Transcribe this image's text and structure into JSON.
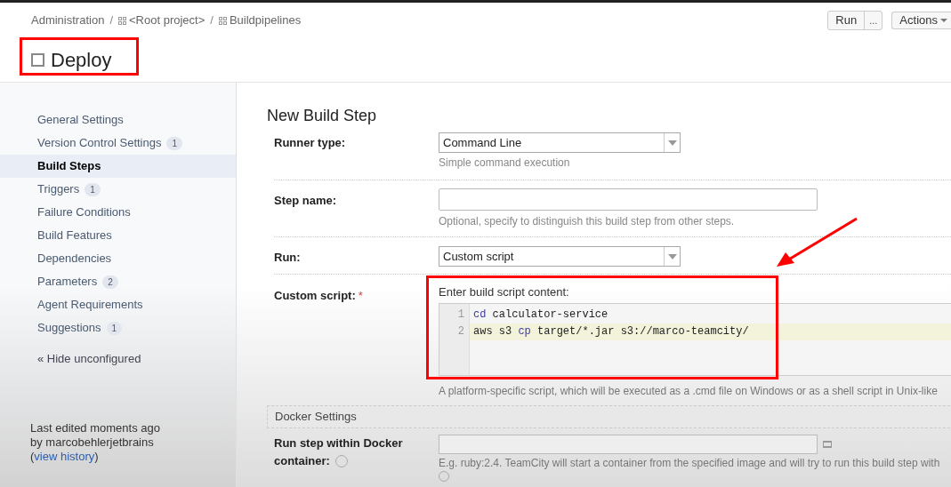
{
  "breadcrumbs": [
    "Administration",
    "<Root project>",
    "Buildpipelines"
  ],
  "breadcrumb_separator": "/",
  "header_buttons": {
    "run": "Run",
    "more": "...",
    "actions": "Actions"
  },
  "title": "Deploy",
  "sidebar": {
    "items": [
      {
        "label": "General Settings",
        "selected": false
      },
      {
        "label": "Version Control Settings",
        "count": "1",
        "selected": false
      },
      {
        "label": "Build Steps",
        "selected": true
      },
      {
        "label": "Triggers",
        "count": "1",
        "selected": false
      },
      {
        "label": "Failure Conditions",
        "selected": false
      },
      {
        "label": "Build Features",
        "selected": false
      },
      {
        "label": "Dependencies",
        "selected": false
      },
      {
        "label": "Parameters",
        "count": "2",
        "selected": false
      },
      {
        "label": "Agent Requirements",
        "selected": false
      },
      {
        "label": "Suggestions",
        "count": "1",
        "selected": false
      }
    ],
    "hide_link": "« Hide unconfigured",
    "edited": {
      "line1": "Last edited moments ago",
      "line2": "by marcobehlerjetbrains",
      "prefix": "(",
      "link": "view history",
      "suffix": ")"
    }
  },
  "form": {
    "heading": "New Build Step",
    "runner_type": {
      "label": "Runner type:",
      "value": "Command Line",
      "hint": "Simple command execution"
    },
    "step_name": {
      "label": "Step name:",
      "hint": "Optional, specify to distinguish this build step from other steps."
    },
    "run": {
      "label": "Run:",
      "value": "Custom script"
    },
    "custom_script": {
      "label": "Custom script:",
      "required": "*",
      "caption": "Enter build script content:",
      "lines": [
        {
          "number": "1",
          "tokens": [
            {
              "kind": "keyword",
              "text": "cd"
            },
            {
              "kind": "plain",
              "text": " calculator-service"
            }
          ]
        },
        {
          "number": "2",
          "tokens": [
            {
              "kind": "plain",
              "text": "aws s3 "
            },
            {
              "kind": "keyword",
              "text": "cp"
            },
            {
              "kind": "plain",
              "text": " target/*.jar s3://marco-teamcity/"
            }
          ]
        }
      ],
      "hint": "A platform-specific script, which will be executed as a .cmd file on Windows or as a shell script in Unix-like"
    },
    "docker_section": "Docker Settings",
    "docker": {
      "label_line1": "Run step within Docker",
      "label_line2": "container:",
      "hint": "E.g. ruby:2.4. TeamCity will start a container from the specified image and will try to run this build step with"
    }
  }
}
